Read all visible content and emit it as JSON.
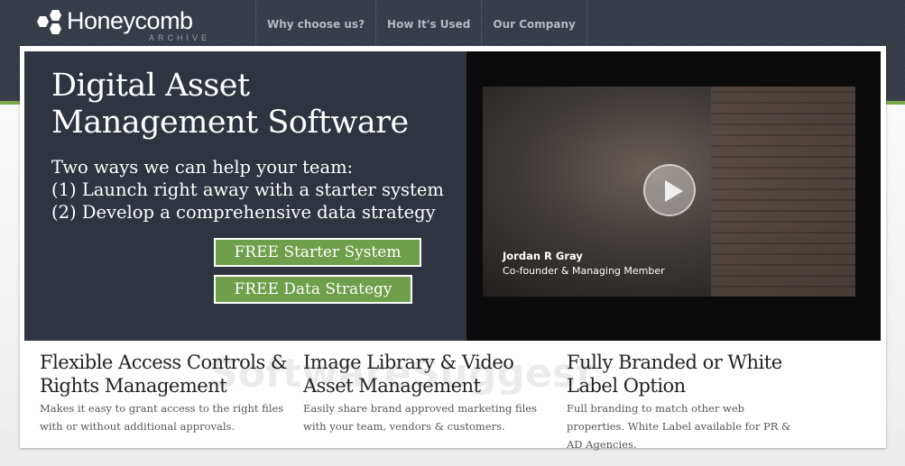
{
  "header": {
    "logo_text": "Honeycomb",
    "logo_sub": "ARCHIVE",
    "nav": [
      "Why choose us?",
      "How It's Used",
      "Our Company"
    ]
  },
  "hero": {
    "title_line1": "Digital Asset",
    "title_line2": "Management Software",
    "sub_line1": "Two ways we can help your team:",
    "sub_line2": "(1) Launch right away with a starter system",
    "sub_line3": "(2) Develop a comprehensive data strategy",
    "btn_starter": "FREE Starter System",
    "btn_strategy": "FREE Data Strategy"
  },
  "video": {
    "name": "Jordan R Gray",
    "role": "Co-founder & Managing Member"
  },
  "features": [
    {
      "title": "Flexible Access Controls & Rights Management",
      "desc": "Makes it easy to grant access to the right files with or without additional approvals."
    },
    {
      "title": "Image Library & Video Asset Management",
      "desc": "Easily share brand approved marketing files with your team, vendors & customers."
    },
    {
      "title": "Fully Branded or White Label Option",
      "desc": "Full branding to match other web properties. White Label available for PR & AD Agencies."
    }
  ],
  "watermark": "SoftwareSuggest",
  "colors": {
    "accent_green": "#6f9f4a",
    "header_bg": "#353c47",
    "hero_bg": "#2e3440"
  }
}
